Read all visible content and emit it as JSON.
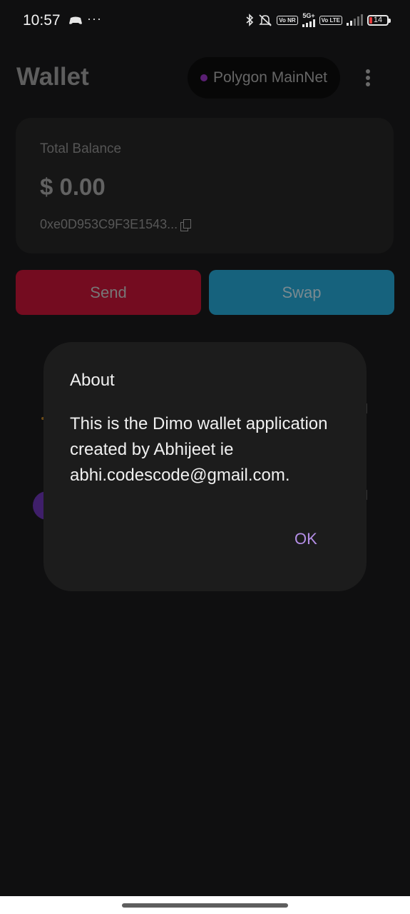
{
  "status_bar": {
    "time": "10:57",
    "more": "···",
    "icons": [
      "game-icon",
      "bluetooth-icon",
      "mute-icon",
      "volte-icon",
      "5g-signal-icon",
      "volte-lte-icon",
      "signal-icon",
      "battery-icon"
    ],
    "volte_label": "Vo NR",
    "fiveg_label": "5G+",
    "lte_label": "Vo LTE",
    "battery": "14"
  },
  "header": {
    "title": "Wallet",
    "network": "Polygon MainNet",
    "menu_icon": "kebab-menu-icon"
  },
  "balance": {
    "label": "Total Balance",
    "amount": "$ 0.00",
    "address": "0xe0D953C9F3E1543...",
    "copy_icon": "copy-icon"
  },
  "actions": {
    "send": "Send",
    "swap": "Swap"
  },
  "dialog": {
    "title": "About",
    "body": "This is the Dimo wallet application created by Abhijeet ie abhi.codescode@gmail.com.",
    "ok": "OK"
  },
  "colors": {
    "background": "#0f0f10",
    "card": "#161616",
    "send": "#740c20",
    "swap": "#16627d",
    "dialog": "#1c1c1c",
    "accent": "#b48ee6",
    "network_dot": "#5a1f73"
  }
}
